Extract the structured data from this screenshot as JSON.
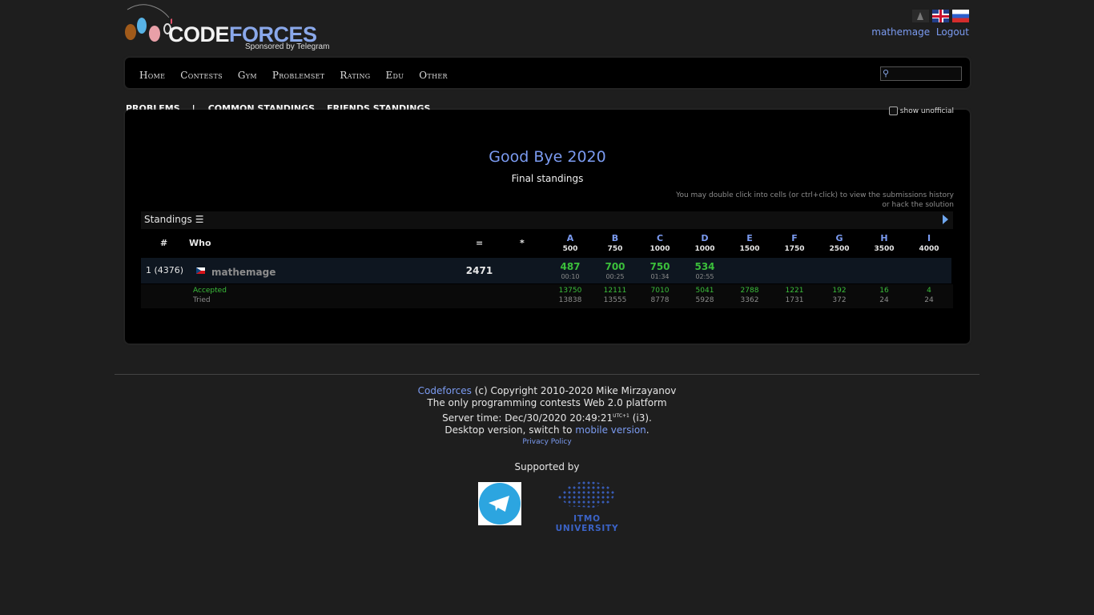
{
  "header": {
    "logo": {
      "word_part1": "CODE",
      "word_part2": "FORCES",
      "sponsor": "Sponsored by Telegram"
    },
    "username": "mathemage",
    "logout": "Logout"
  },
  "menu": {
    "items": [
      "Home",
      "Contests",
      "Gym",
      "Problemset",
      "Rating",
      "Edu",
      "Other"
    ],
    "search_placeholder": ""
  },
  "tabs": {
    "problems": "PROBLEMS",
    "separator": "|",
    "common": "COMMON STANDINGS",
    "friends": "FRIENDS STANDINGS"
  },
  "show_unofficial": "show unofficial",
  "contest": {
    "title": "Good Bye 2020",
    "subtitle": "Final standings",
    "hint_line1": "You may double click into cells (or ctrl+click) to view the submissions history",
    "hint_line2": "or hack the solution"
  },
  "standings": {
    "label": "Standings",
    "headers": {
      "rank": "#",
      "who": "Who",
      "points": "=",
      "penalty": "*"
    },
    "problems": [
      {
        "letter": "A",
        "points": "500"
      },
      {
        "letter": "B",
        "points": "750"
      },
      {
        "letter": "C",
        "points": "1000"
      },
      {
        "letter": "D",
        "points": "1000"
      },
      {
        "letter": "E",
        "points": "1500"
      },
      {
        "letter": "F",
        "points": "1750"
      },
      {
        "letter": "G",
        "points": "2500"
      },
      {
        "letter": "H",
        "points": "3500"
      },
      {
        "letter": "I",
        "points": "4000"
      }
    ],
    "row": {
      "rank": "1 (4376)",
      "who": "mathemage",
      "points": "2471",
      "cells": [
        {
          "score": "487",
          "time": "00:10"
        },
        {
          "score": "700",
          "time": "00:25"
        },
        {
          "score": "750",
          "time": "01:34"
        },
        {
          "score": "534",
          "time": "02:55"
        }
      ]
    },
    "stats": {
      "accepted_label": "Accepted",
      "tried_label": "Tried",
      "accepted": [
        "13750",
        "12111",
        "7010",
        "5041",
        "2788",
        "1221",
        "192",
        "16",
        "4"
      ],
      "tried": [
        "13838",
        "13555",
        "8778",
        "5928",
        "3362",
        "1731",
        "372",
        "24",
        "24"
      ]
    }
  },
  "footer": {
    "link": "Codeforces",
    "copyright": "(c) Copyright 2010-2020 Mike Mirzayanov",
    "tagline": "The only programming contests Web 2.0 platform",
    "server_time_prefix": "Server time: Dec/30/2020 20:49:21",
    "utc": "UTC+1",
    "server_time_suffix": "(i3).",
    "desktop_prefix": "Desktop version, switch to",
    "mobile_link": "mobile version",
    "period": ".",
    "privacy": "Privacy Policy",
    "supported_by": "Supported by",
    "itmo": "ITMO UNIVERSITY"
  },
  "colors": {
    "link": "#7b9bf1",
    "accepted": "#3bbf3b",
    "background": "#1e1e1e"
  }
}
